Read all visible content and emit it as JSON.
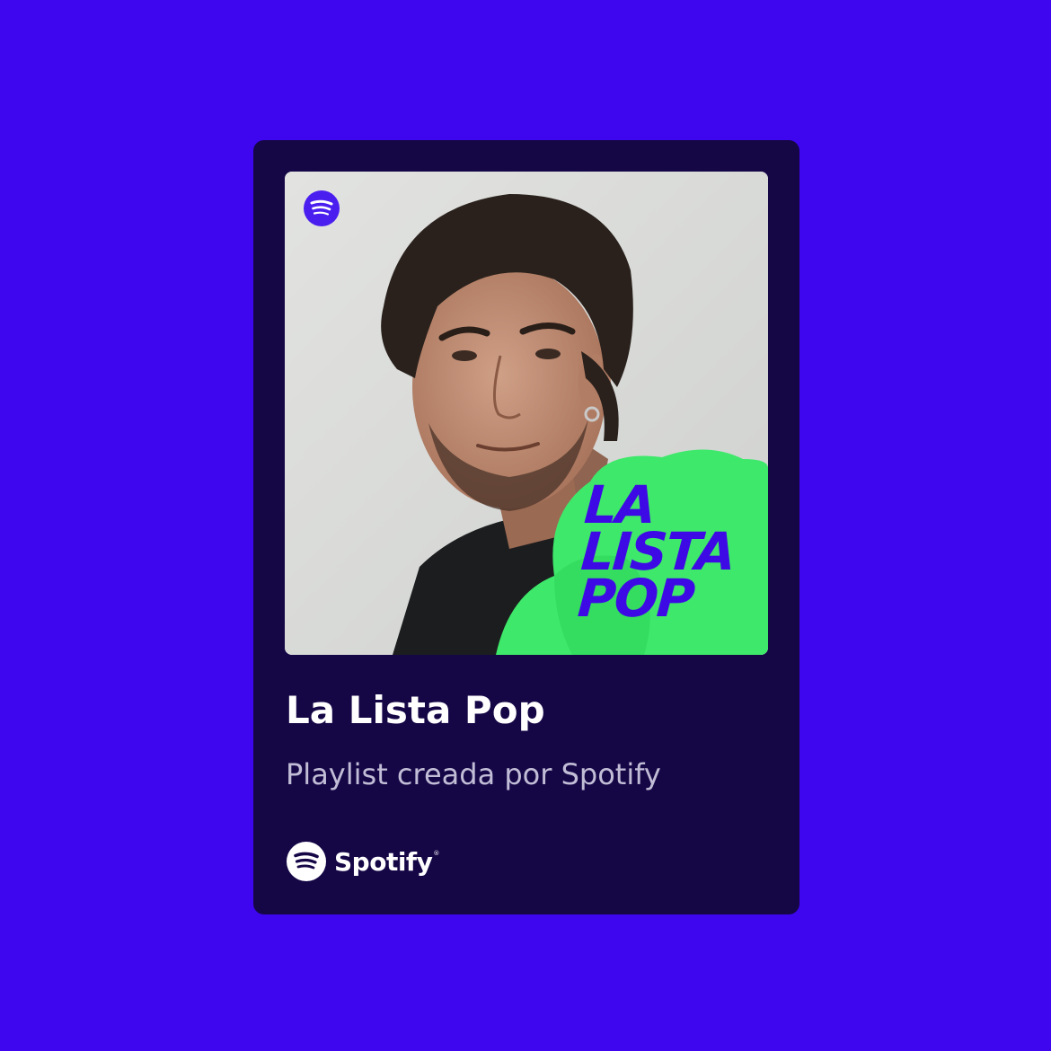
{
  "cover": {
    "title_lines": [
      "LA",
      "LISTA",
      "POP"
    ],
    "logo_icon": "spotify-icon"
  },
  "playlist": {
    "title": "La Lista Pop",
    "subtitle": "Playlist creada por Spotify"
  },
  "brand": {
    "name": "Spotify",
    "mark": "®",
    "icon": "spotify-icon"
  },
  "colors": {
    "background": "#3d06ee",
    "card": "#150646",
    "accent_green": "#3ee86a",
    "cover_title": "#3d0ae6",
    "subtitle": "#c2bdd6"
  }
}
